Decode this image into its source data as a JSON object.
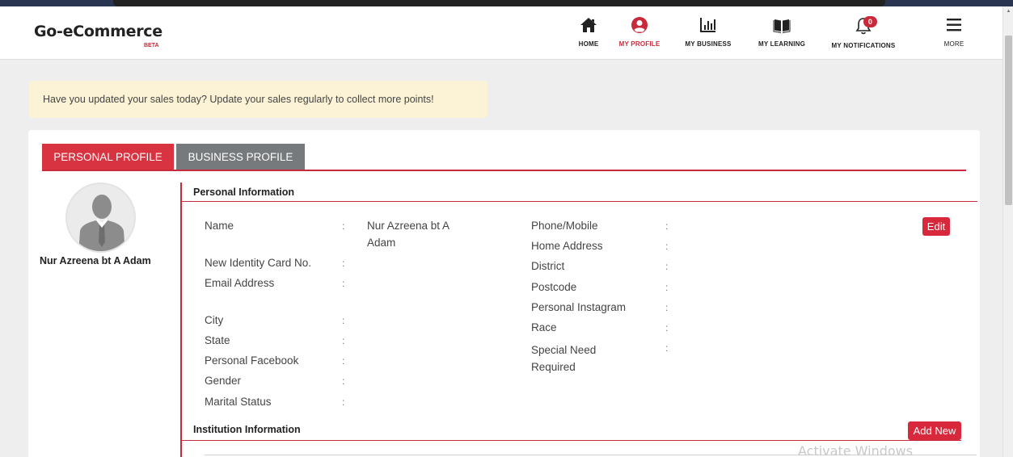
{
  "app": {
    "logo": "Go-eCommerce",
    "logo_tag": "BETA"
  },
  "nav": {
    "home": "HOME",
    "profile": "MY PROFILE",
    "business": "MY BUSINESS",
    "learning": "MY LEARNING",
    "notifications": "MY NOTIFICATIONS",
    "notification_count": "0",
    "more": "MORE"
  },
  "alert": {
    "text": "Have you updated your sales today? Update your sales regularly to collect more points!"
  },
  "tabs": {
    "personal": "PERSONAL PROFILE",
    "business": "BUSINESS PROFILE"
  },
  "profile": {
    "name": "Nur Azreena bt A Adam"
  },
  "personal_info": {
    "title": "Personal Information",
    "edit": "Edit",
    "left_fields": [
      {
        "label": "Name",
        "value_line1": "Nur Azreena bt A",
        "value_line2": "Adam"
      },
      {
        "label": "New Identity Card No."
      },
      {
        "label": "Email Address"
      },
      {
        "label": "City"
      },
      {
        "label": "State"
      },
      {
        "label": "Personal Facebook"
      },
      {
        "label": "Gender"
      },
      {
        "label": "Marital Status"
      }
    ],
    "right_fields": [
      {
        "label": "Phone/Mobile"
      },
      {
        "label": "Home Address"
      },
      {
        "label": "District"
      },
      {
        "label": "Postcode"
      },
      {
        "label": "Personal Instagram"
      },
      {
        "label": "Race"
      },
      {
        "label": "Special Need",
        "label_line2": "Required"
      }
    ],
    "colon": ":"
  },
  "institution": {
    "title": "Institution Information",
    "add_new": "Add New"
  },
  "watermark": "Activate Windows",
  "colors": {
    "accent": "#c92a3b",
    "alert_bg": "#fcf3d6",
    "tab_inactive": "#777a7c"
  }
}
